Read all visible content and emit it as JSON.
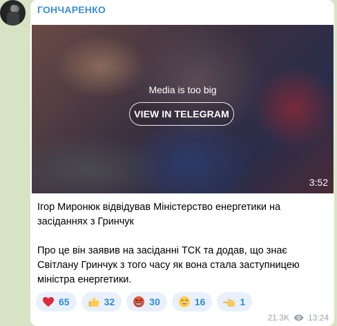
{
  "channel": {
    "name": "ГОНЧАРЕНКО",
    "accent_color": "#3b8ed9"
  },
  "media": {
    "notice": "Media is too big",
    "button_label": "VIEW IN TELEGRAM",
    "duration": "3:52"
  },
  "message": {
    "paragraphs": [
      "Ігор Миронюк відвідував Міністерство енергетики на засіданнях з Гринчук",
      "Про це він заявив на засіданні ТСК та додав, що знає Світлану Гринчук з того часу як вона стала заступницею міністра енергетики."
    ]
  },
  "reactions": [
    {
      "emoji": "heart",
      "count": "65"
    },
    {
      "emoji": "thumbs-up",
      "count": "32"
    },
    {
      "emoji": "angry-face",
      "count": "30"
    },
    {
      "emoji": "grinning-face",
      "count": "16"
    },
    {
      "emoji": "pointing-hand",
      "count": "1"
    }
  ],
  "footer": {
    "views": "21.3K",
    "time": "13:24"
  }
}
